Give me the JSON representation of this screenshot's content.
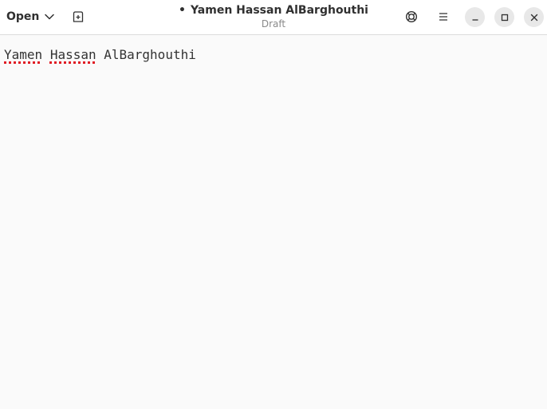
{
  "header": {
    "open_label": "Open",
    "modified_marker": "•",
    "title": "Yamen Hassan AlBarghouthi",
    "subtitle": "Draft"
  },
  "icons": {
    "open_dropdown": "chevron-down-icon",
    "new_tab": "new-tab-icon",
    "lifebuoy": "lifebuoy-icon",
    "menu": "hamburger-menu-icon",
    "minimize": "minimize-icon",
    "maximize": "maximize-icon",
    "close": "close-icon"
  },
  "editor": {
    "words": [
      "Yamen",
      "Hassan",
      "AlBarghouthi"
    ],
    "misspelled_underline_color": "#e01b24"
  },
  "colors": {
    "headerbar_bg": "#ffffff",
    "editor_bg": "#fafafa",
    "text": "#333333"
  }
}
